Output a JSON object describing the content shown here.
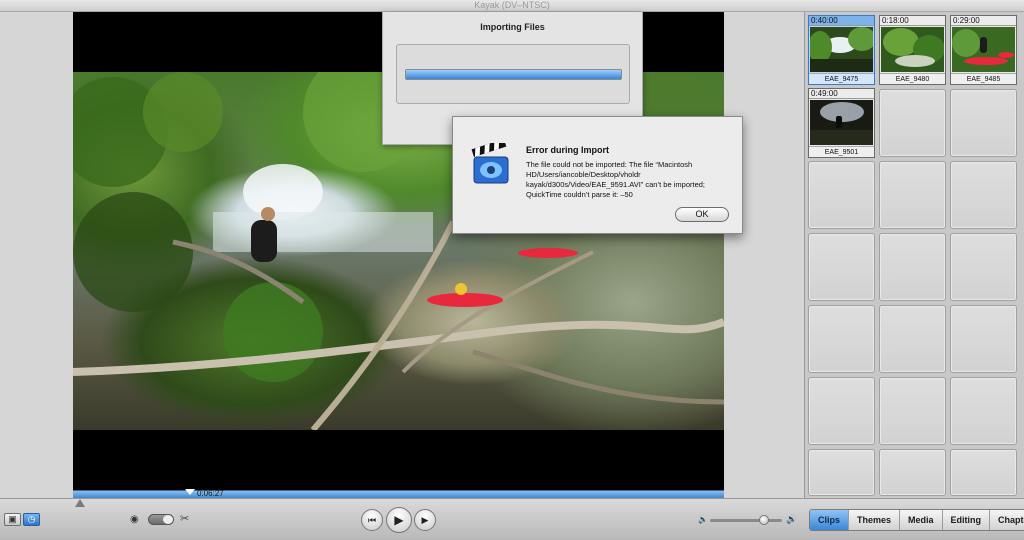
{
  "window": {
    "title": "Kayak (DV–NTSC)"
  },
  "import_panel": {
    "title": "Importing Files",
    "progress": 1.0
  },
  "error_dialog": {
    "title": "Error during Import",
    "message": "The file could not be imported: The file “Macintosh HD/Users/iancoble/Desktop/vholdr kayak/d300s/Video/EAE_9591.AVI” can’t be imported; QuickTime couldn’t parse it: –50",
    "ok_label": "OK",
    "icon": "imovie-clapper-icon"
  },
  "timeline": {
    "playhead_time": "0:06:27"
  },
  "clips": [
    {
      "duration": "0:40:00",
      "name": "EAE_9475",
      "selected": true,
      "thumb": "waterfall-green"
    },
    {
      "duration": "0:18:00",
      "name": "EAE_9480",
      "selected": false,
      "thumb": "forest-stream"
    },
    {
      "duration": "0:29:00",
      "name": "EAE_9485",
      "selected": false,
      "thumb": "kayakers-red"
    },
    {
      "duration": "0:49:00",
      "name": "EAE_9501",
      "selected": false,
      "thumb": "dark-landscape"
    }
  ],
  "empty_slots": 17,
  "panel_tabs": [
    {
      "label": "Clips",
      "selected": true
    },
    {
      "label": "Themes",
      "selected": false
    },
    {
      "label": "Media",
      "selected": false
    },
    {
      "label": "Editing",
      "selected": false
    },
    {
      "label": "Chapters",
      "selected": false
    }
  ],
  "controls": {
    "view_buttons": [
      "clip-viewer-icon",
      "timeline-viewer-icon"
    ],
    "mode_icon": "camera-icon",
    "split_icon": "scissors-icon",
    "transport": [
      "rewind-icon",
      "play-icon",
      "fullscreen-play-icon"
    ],
    "volume_level": 0.75
  },
  "colors": {
    "accent": "#3c86d6",
    "kayak": "#e8283c"
  }
}
